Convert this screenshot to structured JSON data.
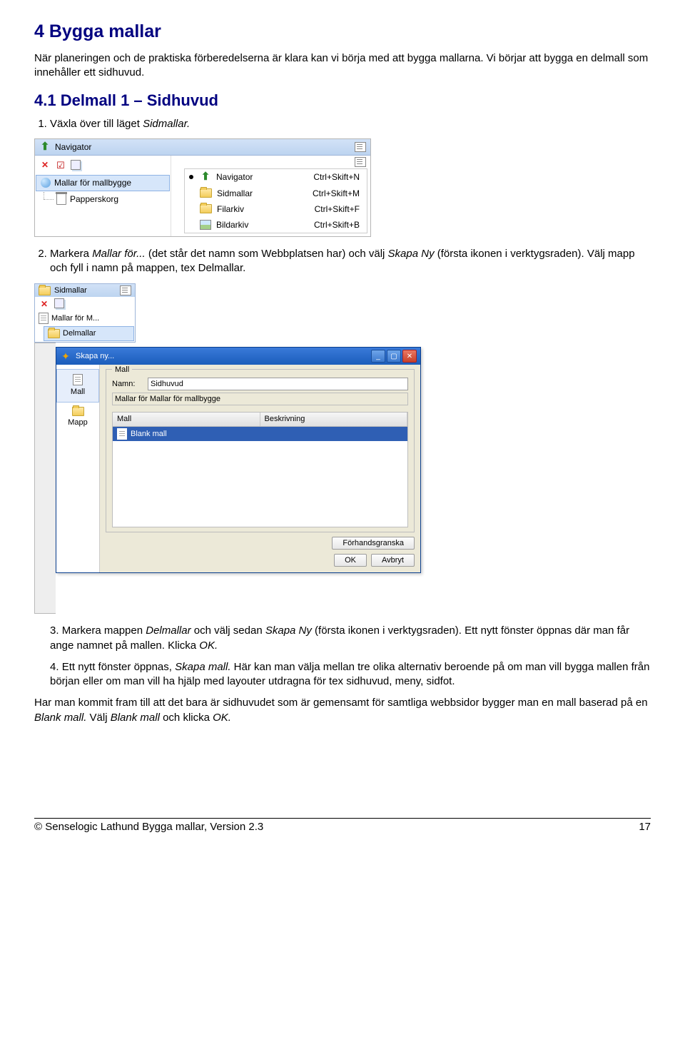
{
  "headings": {
    "h1": "4 Bygga mallar",
    "h2": "4.1 Delmall 1 – Sidhuvud"
  },
  "paragraphs": {
    "intro": "När planeringen och de praktiska förberedelserna är klara kan vi börja med att bygga mallarna. Vi börjar att bygga en delmall som innehåller ett sidhuvud.",
    "step1": "Växla över till läget ",
    "step1_i": "Sidmallar.",
    "step2a": "Markera ",
    "step2b": "Mallar för...",
    "step2c": " (det står det namn som Webbplatsen har) och välj ",
    "step2d": "Skapa Ny",
    "step2e": " (första ikonen i verktygsraden). Välj mapp och fyll i namn på mappen, tex Delmallar.",
    "step3a": "Markera mappen ",
    "step3b": "Delmallar",
    "step3c": " och välj sedan ",
    "step3d": "Skapa Ny ",
    "step3e": "(första ikonen i verktygsraden). Ett nytt fönster öppnas där man får ange namnet på mallen. Klicka ",
    "step3f": "OK.",
    "step4a": "Ett nytt fönster öppnas, ",
    "step4b": "Skapa mall.",
    "step4c": " Här kan man välja mellan tre olika alternativ beroende på om man vill bygga mallen från början eller om man vill ha hjälp med layouter utdragna för tex sidhuvud, meny, sidfot.",
    "p_after": "Har man kommit fram till att det bara är sidhuvudet som är gemensamt för samtliga webbsidor bygger man en mall baserad på en ",
    "p_after_i1": "Blank mall.",
    "p_after2": " Välj ",
    "p_after_i2": "Blank mall",
    "p_after3": " och klicka ",
    "p_after_i3": "OK."
  },
  "nav": {
    "title": "Navigator",
    "tree1": "Mallar för mallbygge",
    "tree2": "Papperskorg",
    "menu": [
      {
        "label": "Navigator",
        "shortcut": "Ctrl+Skift+N"
      },
      {
        "label": "Sidmallar",
        "shortcut": "Ctrl+Skift+M"
      },
      {
        "label": "Filarkiv",
        "shortcut": "Ctrl+Skift+F"
      },
      {
        "label": "Bildarkiv",
        "shortcut": "Ctrl+Skift+B"
      }
    ]
  },
  "sm": {
    "title": "Sidmallar",
    "row1": "Mallar för M...",
    "row2": "Delmallar"
  },
  "dlg": {
    "title": "Skapa ny...",
    "side_mall": "Mall",
    "side_mapp": "Mapp",
    "group": "Mall",
    "lbl_namn": "Namn:",
    "val_namn": "Sidhuvud",
    "lbl_parent": "Mallar för Mallar för mallbygge",
    "col1": "Mall",
    "col2": "Beskrivning",
    "listitem": "Blank mall",
    "btn_preview": "Förhandsgranska",
    "btn_ok": "OK",
    "btn_cancel": "Avbryt"
  },
  "footer": {
    "left": "© Senselogic Lathund Bygga mallar, Version 2.3",
    "right": "17"
  }
}
